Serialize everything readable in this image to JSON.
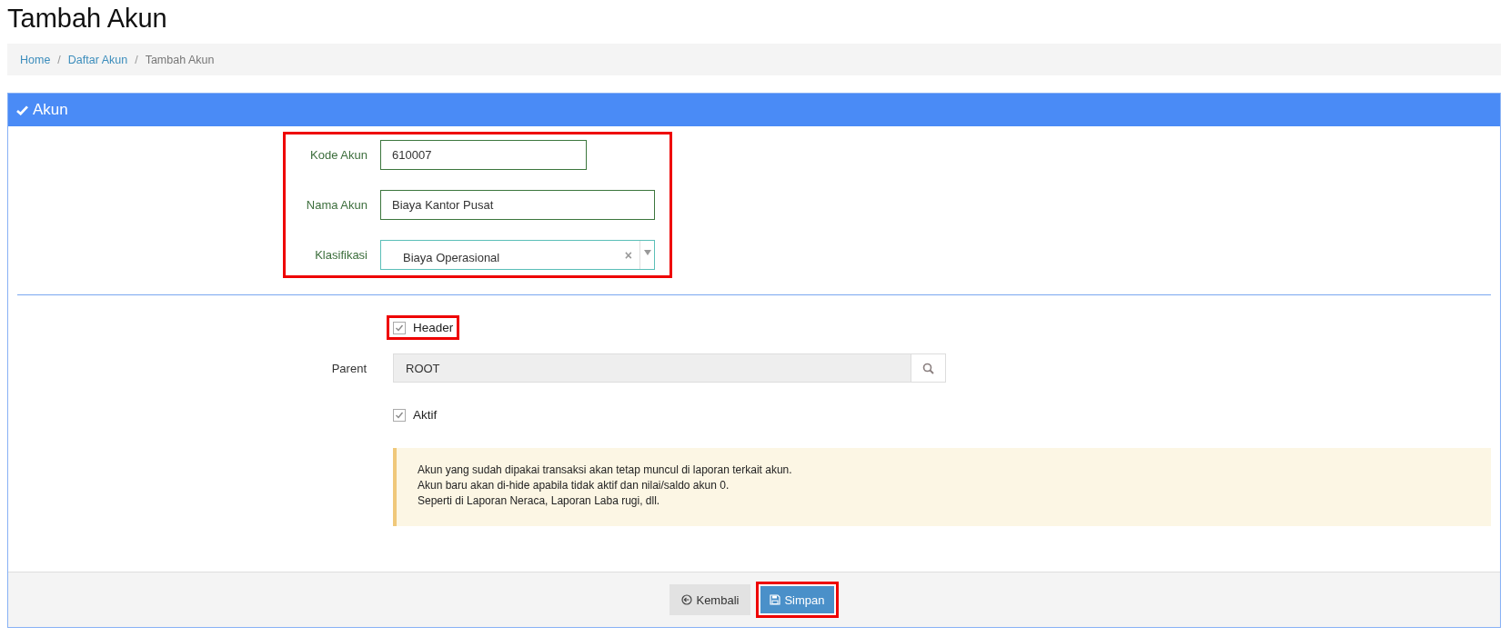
{
  "page_title": "Tambah Akun",
  "breadcrumb_separator": "/",
  "breadcrumb": [
    {
      "label": "Home",
      "link": true
    },
    {
      "label": "Daftar Akun",
      "link": true
    },
    {
      "label": "Tambah Akun",
      "link": false
    }
  ],
  "panel": {
    "title": "Akun"
  },
  "fields": [
    {
      "label": "Kode Akun",
      "value": "610007",
      "kind": "text"
    },
    {
      "label": "Nama Akun",
      "value": "Biaya Kantor Pusat",
      "kind": "text"
    },
    {
      "label": "Klasifikasi",
      "value": "Biaya Operasional",
      "kind": "select",
      "clear": "×"
    }
  ],
  "fields_highlighted": true,
  "header_checkbox": {
    "label": "Header",
    "checked": true,
    "highlighted": true
  },
  "parent": {
    "label": "Parent",
    "value": "ROOT"
  },
  "aktif_checkbox": {
    "label": "Aktif",
    "checked": true
  },
  "notice": [
    "Akun yang sudah dipakai transaksi akan tetap muncul di laporan terkait akun.",
    "Akun baru akan di-hide apabila tidak aktif dan nilai/saldo akun 0.",
    "Seperti di Laporan Neraca, Laporan Laba rugi, dll."
  ],
  "buttons": [
    {
      "label": "Kembali",
      "kind": "back",
      "highlighted": false
    },
    {
      "label": "Simpan",
      "kind": "save",
      "highlighted": true
    }
  ]
}
